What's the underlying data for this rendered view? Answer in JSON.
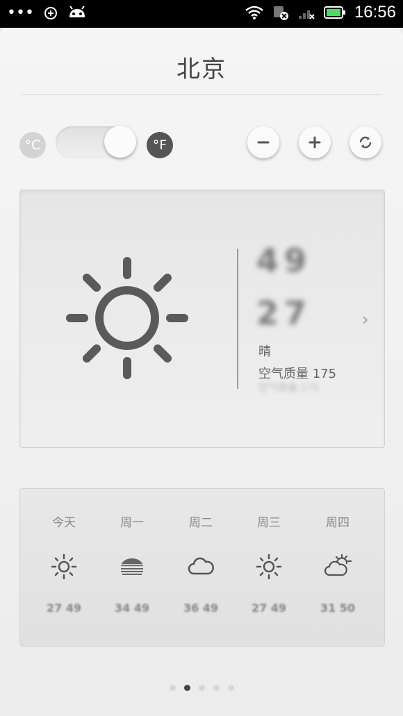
{
  "statusbar": {
    "left_icons": [
      "more-dots-icon",
      "usb-debug-icon",
      "android-icon"
    ],
    "right_icons": [
      "wifi-icon",
      "sim-off-icon",
      "signal-icon",
      "battery-icon"
    ],
    "time": "16:56"
  },
  "header": {
    "city": "北京"
  },
  "controls": {
    "celsius_label": "°C",
    "fahrenheit_label": "°F",
    "unit_toggle_selected": "°F",
    "minus_icon": "minus-icon",
    "plus_icon": "plus-icon",
    "refresh_icon": "refresh-icon"
  },
  "current": {
    "icon": "sun-icon",
    "temp_high": "49",
    "temp_low": "27",
    "condition": "晴",
    "aqi_label": "空气质量 175",
    "chevron": "›"
  },
  "forecast": [
    {
      "day": "今天",
      "icon": "sun-icon",
      "temps": "27 49"
    },
    {
      "day": "周一",
      "icon": "haze-icon",
      "temps": "34 49"
    },
    {
      "day": "周二",
      "icon": "cloud-icon",
      "temps": "36 49"
    },
    {
      "day": "周三",
      "icon": "sun-icon",
      "temps": "27 49"
    },
    {
      "day": "周四",
      "icon": "partly-cloudy-icon",
      "temps": "31 50"
    }
  ],
  "pager": {
    "count": 5,
    "active_index": 1
  },
  "colors": {
    "accent": "#555555",
    "battery_green": "#4cd964"
  }
}
